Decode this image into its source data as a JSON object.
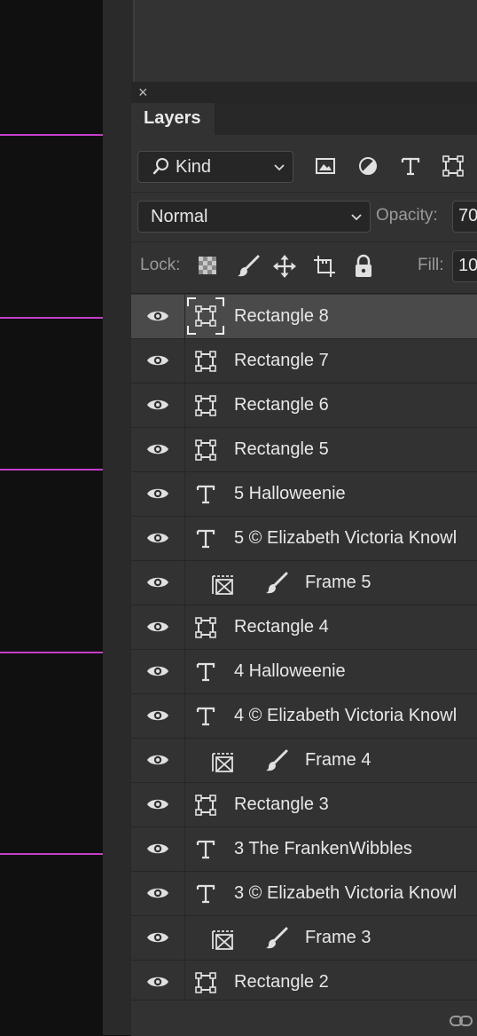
{
  "canvas": {
    "guide_color": "#c53ec8"
  },
  "panel": {
    "close_label": "×",
    "tab_label": "Layers",
    "kind_select": {
      "value": "Kind"
    },
    "filter_icons": [
      "image-filter-icon",
      "adjustment-filter-icon",
      "type-filter-icon",
      "shape-filter-icon"
    ],
    "blend_select": {
      "value": "Normal"
    },
    "opacity": {
      "label": "Opacity:",
      "value": "70"
    },
    "lock": {
      "label": "Lock:",
      "icons": [
        "lock-transparent-pixels-icon",
        "lock-image-pixels-icon",
        "lock-position-icon",
        "lock-artboard-icon",
        "lock-all-icon"
      ]
    },
    "fill": {
      "label": "Fill:",
      "value": "10"
    }
  },
  "layers": [
    {
      "name": "Rectangle 8",
      "type": "shape",
      "indent": false,
      "selected": true
    },
    {
      "name": "Rectangle 7",
      "type": "shape",
      "indent": false,
      "selected": false
    },
    {
      "name": "Rectangle 6",
      "type": "shape",
      "indent": false,
      "selected": false
    },
    {
      "name": "Rectangle 5",
      "type": "shape",
      "indent": false,
      "selected": false
    },
    {
      "name": "5 Halloweenie",
      "type": "text",
      "indent": false,
      "selected": false
    },
    {
      "name": "5 © Elizabeth Victoria Knowl",
      "type": "text",
      "indent": false,
      "selected": false
    },
    {
      "name": "Frame 5",
      "type": "frame",
      "indent": true,
      "selected": false
    },
    {
      "name": "Rectangle 4",
      "type": "shape",
      "indent": false,
      "selected": false
    },
    {
      "name": "4 Halloweenie",
      "type": "text",
      "indent": false,
      "selected": false
    },
    {
      "name": "4 © Elizabeth Victoria Knowl",
      "type": "text",
      "indent": false,
      "selected": false
    },
    {
      "name": "Frame 4",
      "type": "frame",
      "indent": true,
      "selected": false
    },
    {
      "name": "Rectangle 3",
      "type": "shape",
      "indent": false,
      "selected": false
    },
    {
      "name": "3 The FrankenWibbles",
      "type": "text",
      "indent": false,
      "selected": false
    },
    {
      "name": "3 © Elizabeth Victoria Knowl",
      "type": "text",
      "indent": false,
      "selected": false
    },
    {
      "name": "Frame 3",
      "type": "frame",
      "indent": true,
      "selected": false
    },
    {
      "name": "Rectangle 2",
      "type": "shape",
      "indent": false,
      "selected": false
    }
  ]
}
